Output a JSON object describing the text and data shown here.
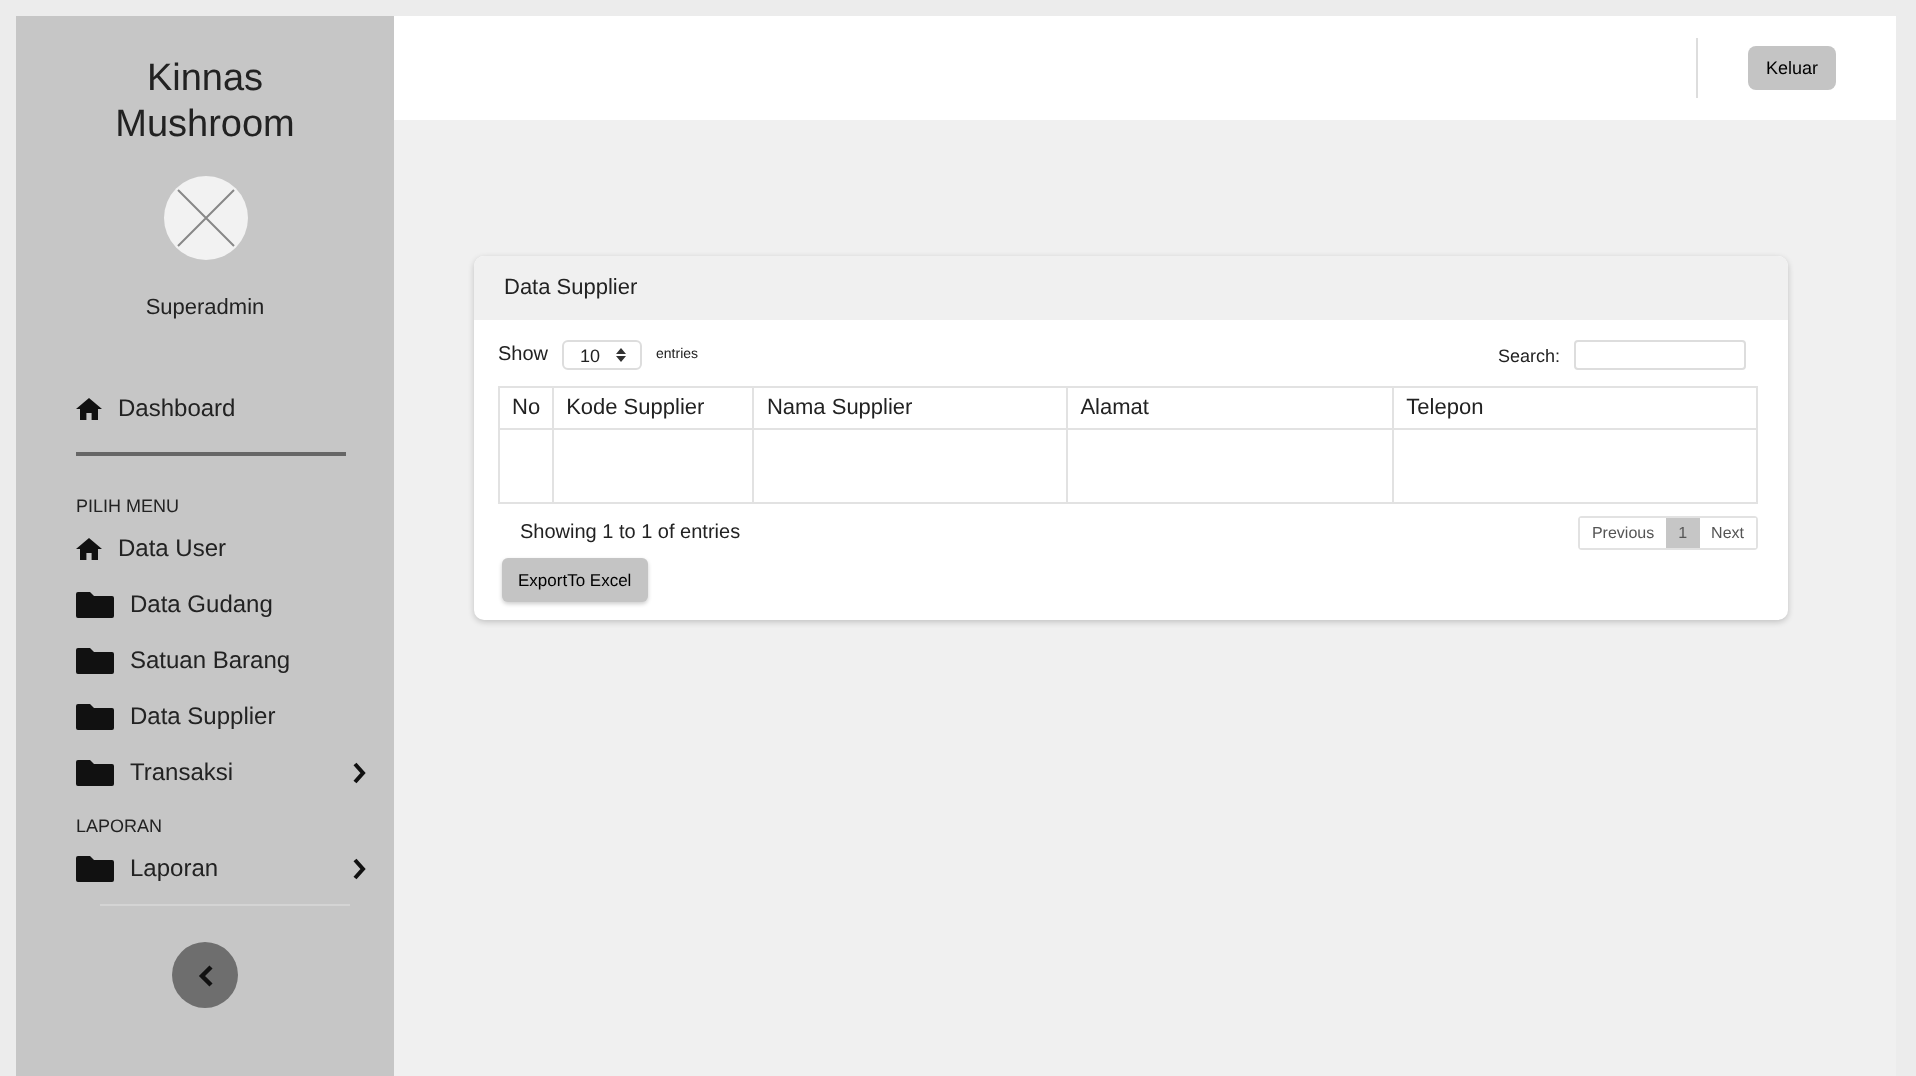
{
  "sidebar": {
    "brand": "Kinnas Mushroom",
    "user": "Superadmin",
    "dashboard": {
      "label": "Dashboard",
      "kind": "home"
    },
    "sections": [
      {
        "heading": "PILIH MENU",
        "items": [
          {
            "label": "Data User",
            "kind": "home",
            "submenu": false
          },
          {
            "label": "Data Gudang",
            "kind": "folder",
            "submenu": false
          },
          {
            "label": "Satuan Barang",
            "kind": "folder",
            "submenu": false
          },
          {
            "label": "Data Supplier",
            "kind": "folder",
            "submenu": false
          },
          {
            "label": "Transaksi",
            "kind": "folder",
            "submenu": true
          }
        ]
      },
      {
        "heading": "LAPORAN",
        "items": [
          {
            "label": "Laporan",
            "kind": "folder",
            "submenu": true
          }
        ]
      }
    ]
  },
  "header": {
    "logout": "Keluar"
  },
  "card": {
    "title": "Data Supplier",
    "show_label": "Show",
    "page_size": "10",
    "entries_label": "entries",
    "search_label": "Search:",
    "columns": [
      "No",
      "Kode Supplier",
      "Nama Supplier",
      "Alamat",
      "Telepon"
    ],
    "info": "Showing 1 to 1 of entries",
    "export": "ExportTo Excel",
    "pagination": [
      {
        "label": "Previous",
        "selected": false
      },
      {
        "label": "1",
        "selected": true
      },
      {
        "label": "Next",
        "selected": false
      }
    ]
  }
}
